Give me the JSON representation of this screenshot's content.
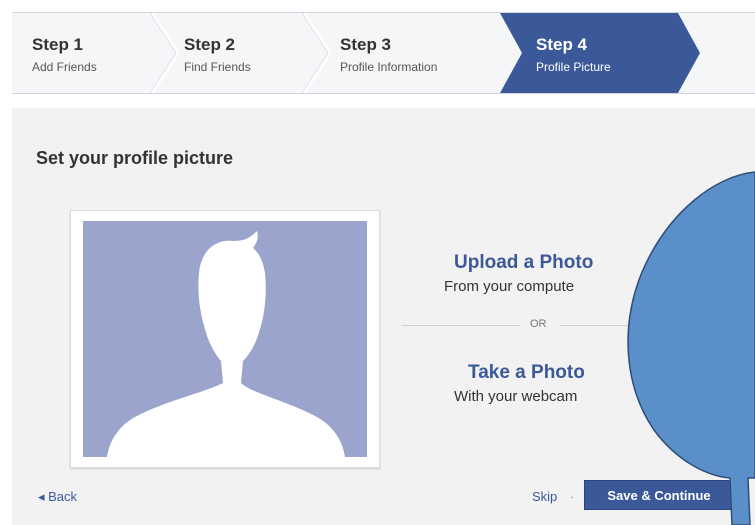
{
  "steps": [
    {
      "title": "Step 1",
      "subtitle": "Add Friends"
    },
    {
      "title": "Step 2",
      "subtitle": "Find Friends"
    },
    {
      "title": "Step 3",
      "subtitle": "Profile Information"
    },
    {
      "title": "Step 4",
      "subtitle": "Profile Picture",
      "active": true
    }
  ],
  "page": {
    "heading": "Set your profile picture"
  },
  "options": {
    "upload_title": "Upload a Photo",
    "upload_sub": "From your compute",
    "or_label": "OR",
    "take_title": "Take a Photo",
    "take_sub": "With your webcam"
  },
  "footer": {
    "back_label": "◂ Back",
    "skip_label": "Skip",
    "skip_separator": "·",
    "save_label": "Save & Continue"
  },
  "colors": {
    "accent": "#3b5998",
    "callout": "#5b8fc9",
    "silhouette_bg": "#9aa4cc"
  },
  "icons": {
    "profile_placeholder": "default-silhouette-icon"
  }
}
